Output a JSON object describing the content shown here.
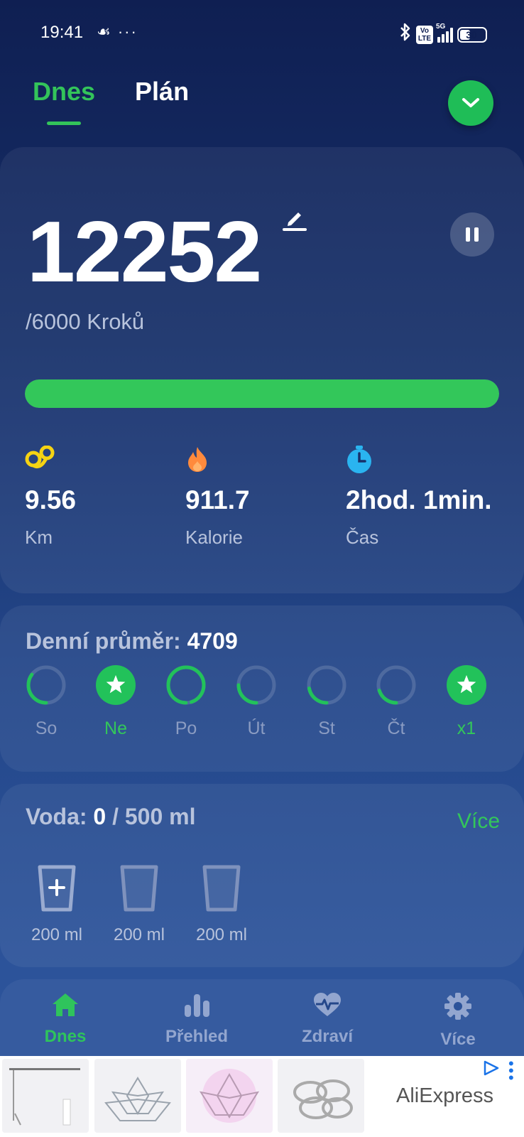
{
  "status_bar": {
    "time": "19:41",
    "left_icons": "☙ ···",
    "volte": "Vo\nLTE",
    "network": "5G",
    "battery": "30"
  },
  "top_tabs": [
    {
      "label": "Dnes",
      "active": true
    },
    {
      "label": "Plán",
      "active": false
    }
  ],
  "steps": {
    "count": "12252",
    "goal": "/6000 Kroků",
    "progress_fraction": 1.0,
    "metrics": [
      {
        "icon": "distance-icon",
        "value": "9.56",
        "label": "Km"
      },
      {
        "icon": "flame-icon",
        "value": "911.7",
        "label": "Kalorie"
      },
      {
        "icon": "stopwatch-icon",
        "value": "2hod. 1min.",
        "label": "Čas"
      }
    ]
  },
  "average": {
    "label": "Denní průměr: ",
    "value": "4709",
    "days": [
      {
        "label": "So",
        "type": "ring",
        "fraction": 0.35
      },
      {
        "label": "Ne",
        "type": "star"
      },
      {
        "label": "Po",
        "type": "ring",
        "fraction": 0.95
      },
      {
        "label": "Út",
        "type": "ring",
        "fraction": 0.25
      },
      {
        "label": "St",
        "type": "ring",
        "fraction": 0.22
      },
      {
        "label": "Čt",
        "type": "ring",
        "fraction": 0.2
      },
      {
        "label": "x1",
        "type": "star"
      }
    ]
  },
  "water": {
    "label": "Voda: ",
    "value": "0",
    "goal": " / 500 ml",
    "more": "Více",
    "cups": [
      {
        "label": "200 ml",
        "add": true
      },
      {
        "label": "200 ml",
        "add": false
      },
      {
        "label": "200 ml",
        "add": false
      }
    ]
  },
  "bottom_nav": [
    {
      "label": "Dnes",
      "icon": "home-icon",
      "active": true
    },
    {
      "label": "Přehled",
      "icon": "bar-chart-icon",
      "active": false
    },
    {
      "label": "Zdraví",
      "icon": "heart-pulse-icon",
      "active": false
    },
    {
      "label": "Více",
      "icon": "gear-icon",
      "active": false
    }
  ],
  "ad": {
    "brand": "AliExpress"
  },
  "colors": {
    "accent": "#33c75a",
    "background_top": "#0f1f52",
    "background_bottom": "#2c539a"
  }
}
